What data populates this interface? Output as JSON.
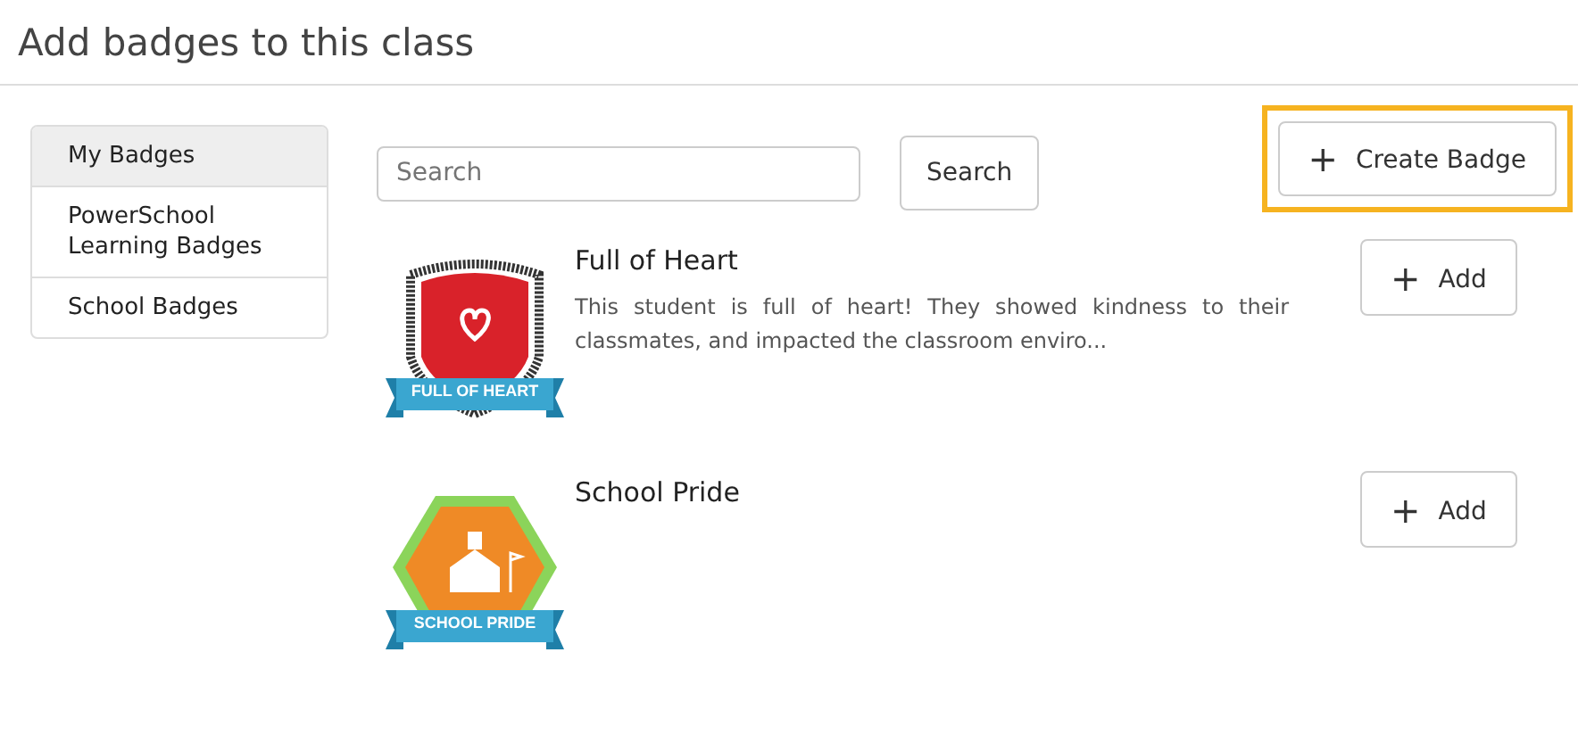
{
  "page": {
    "title": "Add badges to this class"
  },
  "sidebar": {
    "items": [
      {
        "label": "My Badges",
        "selected": true
      },
      {
        "label": "PowerSchool Learning Badges",
        "selected": false
      },
      {
        "label": "School Badges",
        "selected": false
      }
    ]
  },
  "search": {
    "placeholder": "Search",
    "button": "Search"
  },
  "create_button": {
    "icon": "+",
    "label": "Create Badge",
    "highlighted": true
  },
  "badges": [
    {
      "kind": "shield",
      "ribbon": "FULL OF HEART",
      "title": "Full of Heart",
      "description": "This student is full of heart! They showed kindness to their classmates, and impacted the classroom enviro...",
      "add_icon": "+",
      "add_label": "Add"
    },
    {
      "kind": "hexagon",
      "ribbon": "SCHOOL PRIDE",
      "title": "School Pride",
      "add_icon": "+",
      "add_label": "Add"
    }
  ]
}
